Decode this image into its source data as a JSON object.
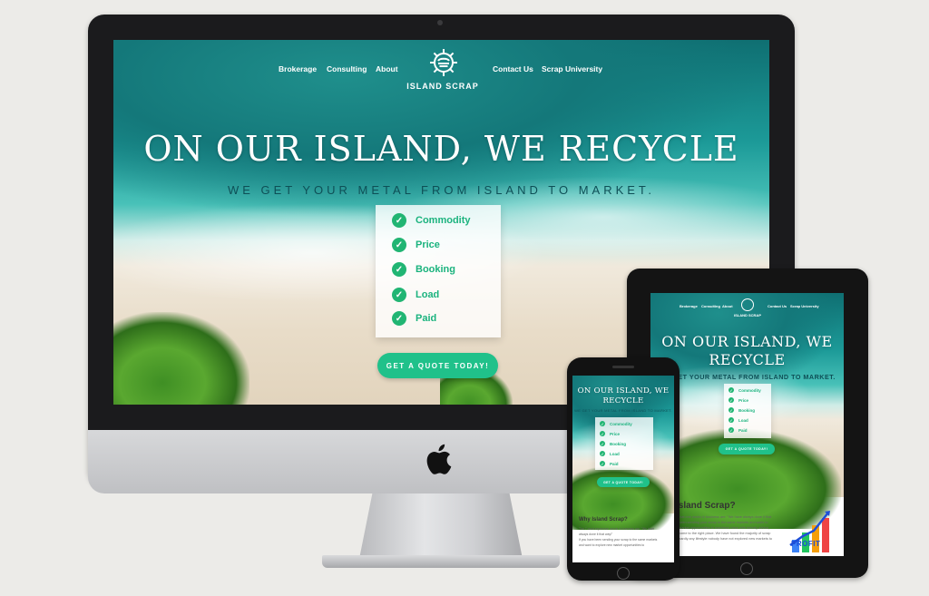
{
  "brand": {
    "name": "ISLAND SCRAP",
    "accent": "#20c18a"
  },
  "nav": {
    "left": [
      "Brokerage",
      "Consulting",
      "About"
    ],
    "right": [
      "Contact Us",
      "Scrap University"
    ]
  },
  "hero": {
    "headline": "ON OUR ISLAND, WE RECYCLE",
    "tagline": "WE GET YOUR METAL FROM ISLAND TO MARKET.",
    "checklist": [
      "Commodity",
      "Price",
      "Booking",
      "Load",
      "Paid"
    ],
    "cta": "GET A QUOTE TODAY!"
  },
  "tablet": {
    "headline_line1": "ON OUR ISLAND, WE",
    "headline_line2": "RECYCLE",
    "tagline": "WE GET YOUR METAL FROM ISLAND TO MARKET.",
    "section_title": "Island Scrap?",
    "body_lines": [
      "...that one works in business are: \"We have always done it that",
      "...been sending your scrap to the same markets and waits to",
      "...market opportunities to maximize value with friendly advice,",
      "...come to the right place. We have found the majority of scrap",
      "...hardly any lifestyle nobody have not explored new markets to"
    ],
    "chart_label": "PROFIT"
  },
  "phone": {
    "headline_line1": "ON OUR ISLAND, WE",
    "headline_line2": "RECYCLE",
    "section_title": "Why Island Scrap?",
    "body_lines": [
      "The 7 most expensive words in business are: \"We have",
      "always done it that way!\"",
      "If you have been sending your scrap to the same markets",
      "and want to explore new market opportunities to"
    ]
  }
}
